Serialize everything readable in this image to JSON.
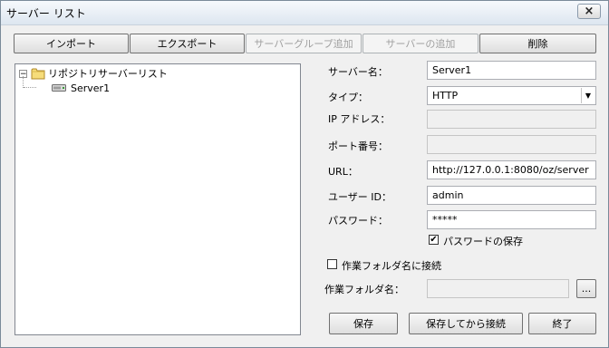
{
  "window": {
    "title": "サーバー リスト",
    "close_glyph": "×"
  },
  "toolbar": {
    "import_label": "インポート",
    "export_label": "エクスポート",
    "add_group_label": "サーバーグループ追加",
    "add_server_label": "サーバーの追加",
    "delete_label": "削除"
  },
  "tree": {
    "root_label": "リポジトリサーバーリスト",
    "expander_glyph": "−",
    "children": [
      {
        "label": "Server1"
      }
    ]
  },
  "form": {
    "server_name_label": "サーバー名：",
    "server_name_value": "Server1",
    "type_label": "タイプ：",
    "type_value": "HTTP",
    "ip_label": "IP アドレス：",
    "ip_value": "",
    "port_label": "ポート番号：",
    "port_value": "",
    "url_label": "URL：",
    "url_value": "http://127.0.0.1:8080/oz/server",
    "user_id_label": "ユーザー ID：",
    "user_id_value": "admin",
    "password_label": "パスワード：",
    "password_value": "*****",
    "save_password_label": "パスワードの保存",
    "save_password_checked": true,
    "connect_folder_label": "作業フォルダ名に接続",
    "connect_folder_checked": false,
    "folder_label": "作業フォルダ名：",
    "folder_value": "",
    "browse_label": "..."
  },
  "footer": {
    "save_label": "保存",
    "save_connect_label": "保存してから接続",
    "exit_label": "終了"
  },
  "icons": {
    "folder": "folder-icon",
    "server": "server-icon",
    "close": "close-icon",
    "dropdown": "chevron-down-icon",
    "check": "check-icon"
  }
}
